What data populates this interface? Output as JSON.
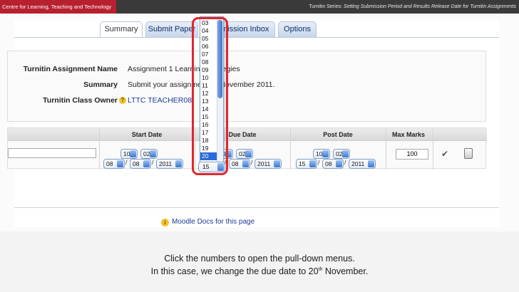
{
  "banner": {
    "left": "Centre for Learning, Teaching and Technology",
    "series_label": "Turnitin Series:",
    "series_title": "Setting Submission Period and Results Release Date for Turnitin Assignments"
  },
  "tabs": [
    {
      "label": "Summary",
      "active": true
    },
    {
      "label": "Submit Paper",
      "active": false
    },
    {
      "label": "Submission Inbox",
      "active": false
    },
    {
      "label": "Options",
      "active": false
    }
  ],
  "info": {
    "name_label": "Turnitin Assignment Name",
    "name_value": "Assignment 1 Learning Strategies",
    "summary_label": "Summary",
    "summary_value": "Submit your assignment by November 2011.",
    "owner_label": "Turnitin Class Owner",
    "owner_value": "LTTC TEACHER08"
  },
  "dates": {
    "headers": {
      "start": "Start Date",
      "due": "Due Date",
      "post": "Post Date",
      "marks": "Max Marks"
    },
    "start": {
      "hour": "10",
      "minute": "02",
      "day": "08",
      "month": "08",
      "year": "2011"
    },
    "due": {
      "hour": "10",
      "minute": "02",
      "day": "15",
      "month": "08",
      "year": "2011"
    },
    "post": {
      "hour": "10",
      "minute": "02",
      "day": "15",
      "month": "08",
      "year": "2011"
    },
    "max_marks": "100"
  },
  "dropdown": {
    "items": [
      "03",
      "04",
      "05",
      "06",
      "07",
      "08",
      "09",
      "10",
      "11",
      "12",
      "13",
      "14",
      "15",
      "16",
      "17",
      "18",
      "19",
      "20"
    ],
    "selected": "20",
    "current_value": "15"
  },
  "docs_link": "Moodle Docs for this page",
  "caption": {
    "line1": "Click the numbers to open the pull-down menus.",
    "line2_pre": "In this case, we change the due date to 20",
    "line2_sup": "th",
    "line2_post": " November."
  },
  "colors": {
    "brand_red": "#b7202e",
    "dark_bar": "#3a3a3a",
    "link_blue": "#1d3c96",
    "highlight": "#e0262d"
  }
}
